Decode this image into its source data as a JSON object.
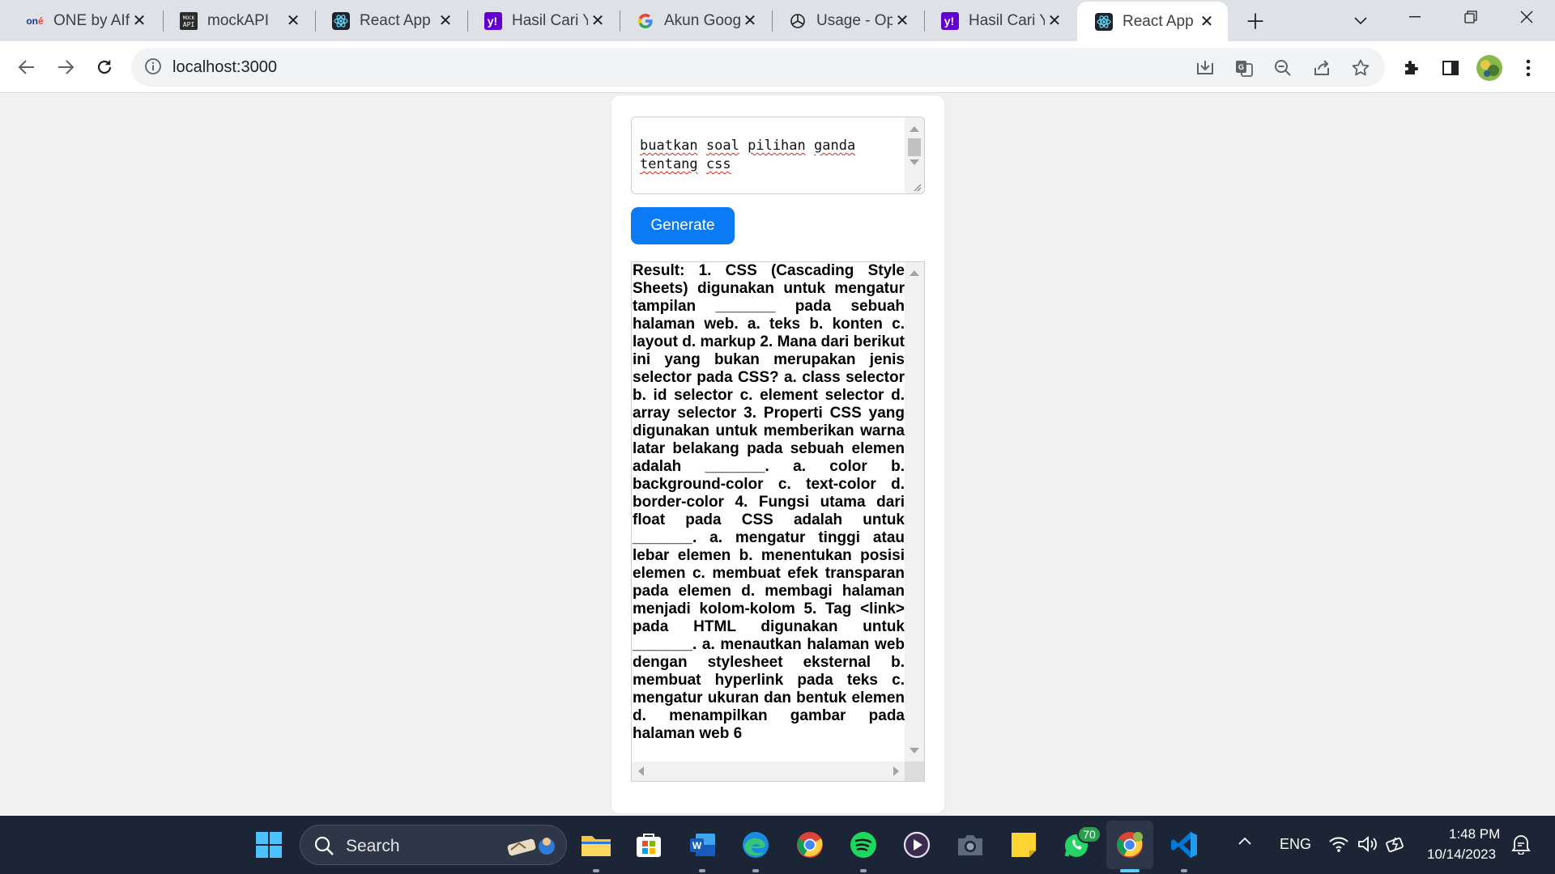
{
  "tabs": [
    {
      "title": "ONE by AIf",
      "favicon": "one-logo"
    },
    {
      "title": "mockAPI",
      "favicon": "mockapi-logo"
    },
    {
      "title": "React App",
      "favicon": "react-logo"
    },
    {
      "title": "Hasil Cari Y",
      "favicon": "yahoo-logo"
    },
    {
      "title": "Akun Goog",
      "favicon": "google-logo"
    },
    {
      "title": "Usage - Op",
      "favicon": "openai-logo"
    },
    {
      "title": "Hasil Cari Y",
      "favicon": "yahoo-logo"
    },
    {
      "title": "React App",
      "favicon": "react-logo",
      "active": true
    }
  ],
  "toolbar": {
    "url": "localhost:3000"
  },
  "app": {
    "prompt_value": "buatkan soal pilihan ganda tentang css",
    "prompt_words_line1": [
      "buatkan",
      "soal",
      "pilihan",
      "ganda"
    ],
    "prompt_words_line2": [
      "tentang",
      "css"
    ],
    "generate_label": "Generate",
    "result_text": "Result: 1. CSS (Cascading Style Sheets) digunakan untuk mengatur tampilan _______ pada sebuah halaman web. a. teks b. konten c. layout d. markup 2. Mana dari berikut ini yang bukan merupakan jenis selector pada CSS? a. class selector b. id selector c. element selector d. array selector 3. Properti CSS yang digunakan untuk memberikan warna latar belakang pada sebuah elemen adalah _______. a. color b. background-color c. text-color d. border-color 4. Fungsi utama dari float pada CSS adalah untuk _______. a. mengatur tinggi atau lebar elemen b. menentukan posisi elemen c. membuat efek transparan pada elemen d. membagi halaman menjadi kolom-kolom 5. Tag <link> pada HTML digunakan untuk _______. a. menautkan halaman web dengan stylesheet eksternal b. membuat hyperlink pada teks c. mengatur ukuran dan bentuk elemen d. menampilkan gambar pada halaman web 6"
  },
  "taskbar": {
    "search_label": "Search",
    "whatsapp_badge": "70",
    "language": "ENG",
    "time": "1:48 PM",
    "date": "10/14/2023"
  },
  "colors": {
    "accent": "#0b7af5",
    "tabstrip": "#dee1e6",
    "taskbar": "#1c2536",
    "page_bg": "#f1f1f1"
  }
}
